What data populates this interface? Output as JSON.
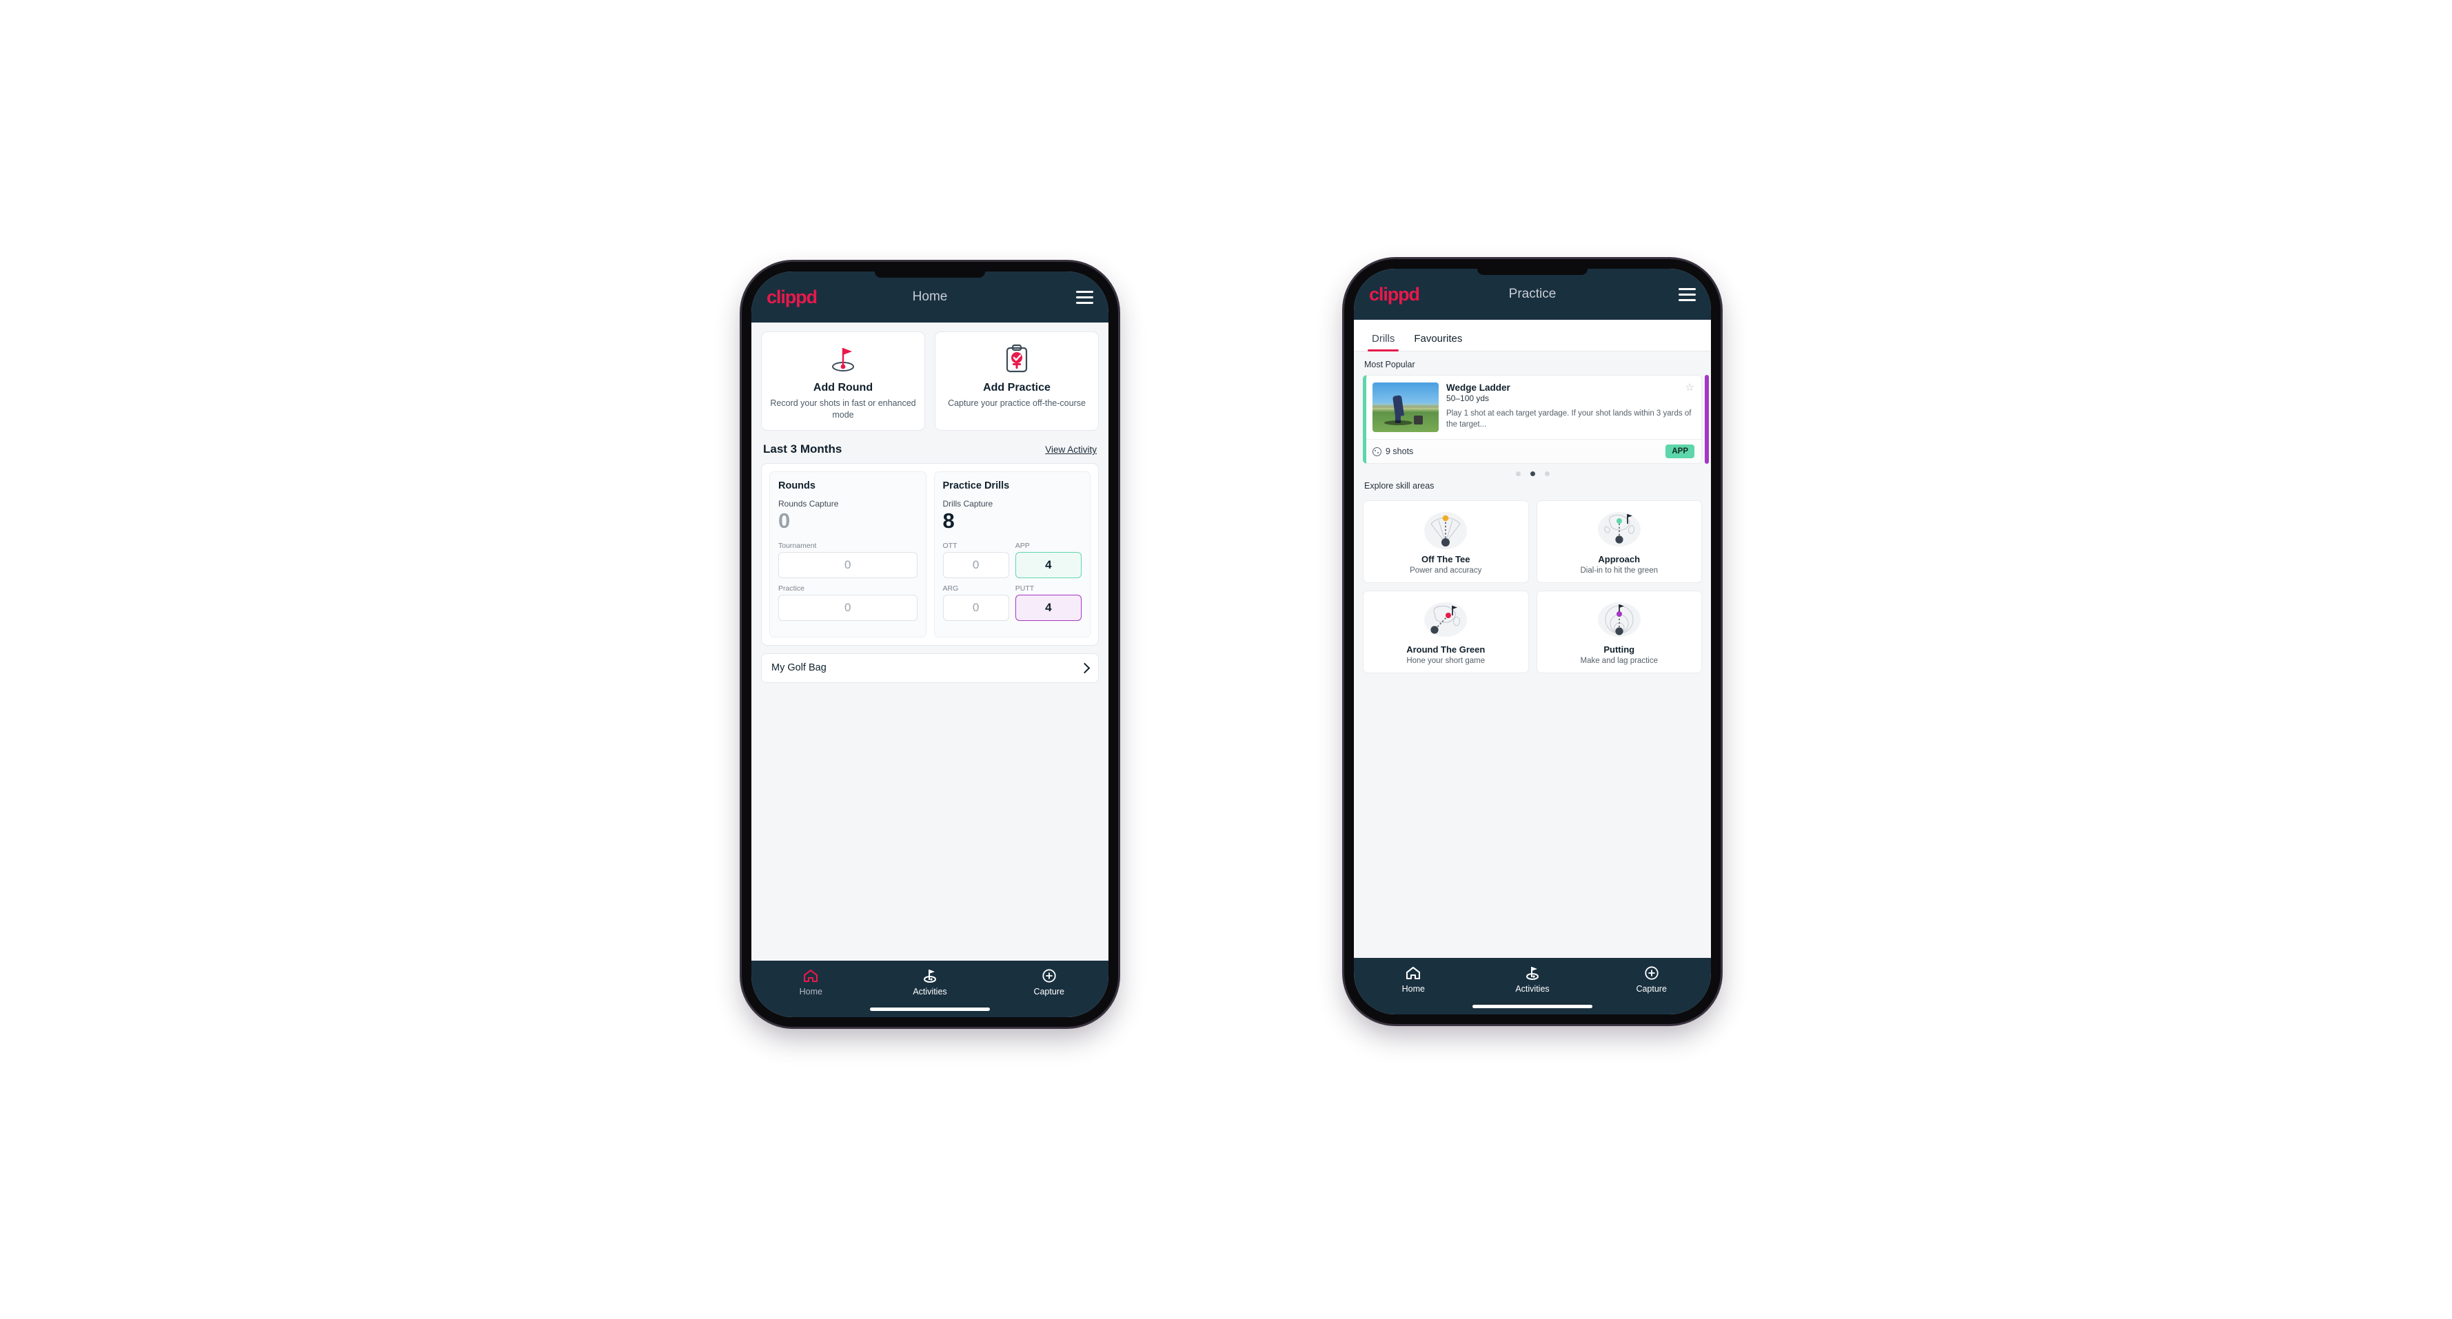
{
  "brand": "clippd",
  "phone1": {
    "appbar": {
      "title": "Home",
      "menu_icon": "hamburger-menu-icon"
    },
    "actions": [
      {
        "icon": "golf-flag-hole-icon",
        "title": "Add Round",
        "sub": "Record your shots in fast or enhanced mode"
      },
      {
        "icon": "clipboard-check-tee-icon",
        "title": "Add Practice",
        "sub": "Capture your practice off-the-course"
      }
    ],
    "section": {
      "title": "Last 3 Months",
      "link": "View Activity"
    },
    "rounds": {
      "heading": "Rounds",
      "capture_label": "Rounds Capture",
      "capture_value": "0",
      "fields": [
        {
          "label": "Tournament",
          "value": "0",
          "state": "empty"
        },
        {
          "label": "Practice",
          "value": "0",
          "state": "empty"
        }
      ]
    },
    "drills": {
      "heading": "Practice Drills",
      "capture_label": "Drills Capture",
      "capture_value": "8",
      "fields": [
        {
          "label": "OTT",
          "value": "0",
          "state": "empty"
        },
        {
          "label": "APP",
          "value": "4",
          "state": "app"
        },
        {
          "label": "ARG",
          "value": "0",
          "state": "empty"
        },
        {
          "label": "PUTT",
          "value": "4",
          "state": "putt"
        }
      ]
    },
    "golfbag": {
      "label": "My Golf Bag",
      "icon": "chevron-right-icon"
    },
    "nav": [
      {
        "icon": "home-icon",
        "label": "Home",
        "active": true
      },
      {
        "icon": "golf-flag-icon",
        "label": "Activities",
        "active": false
      },
      {
        "icon": "plus-circle-icon",
        "label": "Capture",
        "active": false
      }
    ]
  },
  "phone2": {
    "appbar": {
      "title": "Practice",
      "menu_icon": "hamburger-menu-icon"
    },
    "tabs": [
      {
        "label": "Drills",
        "selected": true
      },
      {
        "label": "Favourites",
        "selected": false
      }
    ],
    "most_popular_label": "Most Popular",
    "drill": {
      "title": "Wedge Ladder",
      "yardage": "50–100 yds",
      "description": "Play 1 shot at each target yardage. If your shot lands within 3 yards of the target...",
      "shots": "9 shots",
      "badge": "APP",
      "star_icon": "star-outline-icon",
      "shots_icon": "golf-ball-icon",
      "accent_color": "#5ed6ab",
      "peek_accent_color": "#a437c4"
    },
    "carousel_dots": {
      "count": 3,
      "active_index": 1
    },
    "explore_label": "Explore skill areas",
    "skills": [
      {
        "icon": "tee-dispersion-fan-icon",
        "name": "Off The Tee",
        "sub": "Power and accuracy",
        "dot_color": "#f0ad23"
      },
      {
        "icon": "green-approach-icon",
        "name": "Approach",
        "sub": "Dial-in to hit the green",
        "dot_color": "#5ed6ab"
      },
      {
        "icon": "chip-around-green-icon",
        "name": "Around The Green",
        "sub": "Hone your short game",
        "dot_color": "#e8194b"
      },
      {
        "icon": "putting-rings-icon",
        "name": "Putting",
        "sub": "Make and lag practice",
        "dot_color": "#a437c4"
      }
    ],
    "nav": [
      {
        "icon": "home-icon",
        "label": "Home",
        "active": false
      },
      {
        "icon": "golf-flag-icon",
        "label": "Activities",
        "active": false
      },
      {
        "icon": "plus-circle-icon",
        "label": "Capture",
        "active": false
      }
    ]
  },
  "colors": {
    "brand_pink": "#e8194b",
    "appbar_dark": "#19303f",
    "app_green": "#5ed6ab",
    "putt_purple": "#a437c4",
    "page_bg": "#f5f6f8"
  }
}
